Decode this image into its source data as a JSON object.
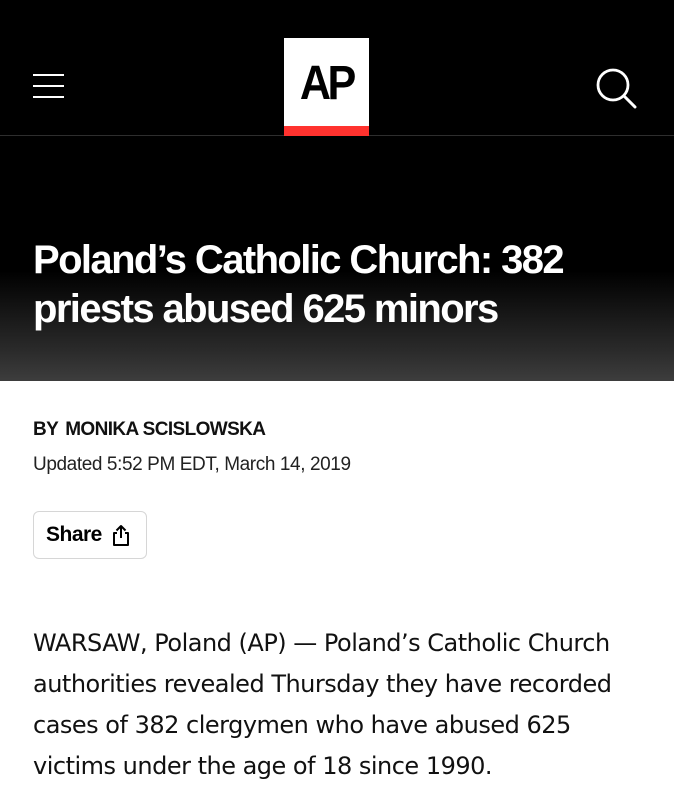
{
  "header": {
    "logo_text": "AP",
    "colors": {
      "background": "#000000",
      "logo_bg": "#ffffff",
      "logo_accent": "#ff322e"
    },
    "icons": {
      "menu": "hamburger-menu-icon",
      "search": "search-icon"
    }
  },
  "article": {
    "headline": "Poland’s Catholic Church: 382 priests abused 625 minors",
    "byline_prefix": "BY",
    "author": "MONIKA SCISLOWSKA",
    "updated": "Updated 5:52 PM EDT, March 14, 2019",
    "share_label": "Share",
    "share_icon": "share-icon",
    "body_paragraph": "WARSAW, Poland (AP) — Poland’s Catholic Church authorities revealed Thursday they have recorded cases of 382 clergymen who have abused 625 victims under the age of 18 since 1990."
  }
}
